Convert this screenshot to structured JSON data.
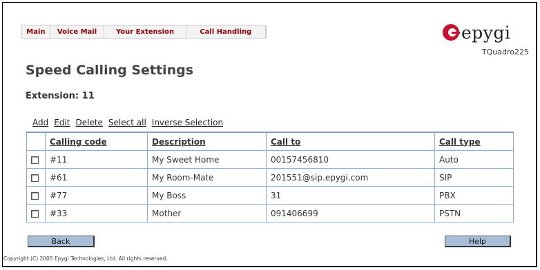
{
  "nav": {
    "tabs": [
      {
        "label": "Main"
      },
      {
        "label": "Voice Mail"
      },
      {
        "label": "Your Extension"
      },
      {
        "label": "Call Handling"
      }
    ]
  },
  "brand": {
    "logo_text": "epygi",
    "model": "TQuadro225",
    "accent": "#c8102e"
  },
  "page": {
    "title": "Speed Calling Settings",
    "extension_label": "Extension: 11"
  },
  "actions": {
    "add": "Add",
    "edit": "Edit",
    "delete": "Delete",
    "select_all": "Select all",
    "inverse": "Inverse Selection"
  },
  "table": {
    "headers": [
      "Calling code",
      "Description",
      "Call to",
      "Call type"
    ],
    "rows": [
      {
        "code": "#11",
        "description": "My Sweet Home",
        "call_to": "00157456810",
        "type": "Auto"
      },
      {
        "code": "#61",
        "description": "My Room-Mate",
        "call_to": "201551@sip.epygi.com",
        "type": "SIP"
      },
      {
        "code": "#77",
        "description": "My Boss",
        "call_to": "31",
        "type": "PBX"
      },
      {
        "code": "#33",
        "description": "Mother",
        "call_to": "091406699",
        "type": "PSTN"
      }
    ]
  },
  "buttons": {
    "back": "Back",
    "help": "Help"
  },
  "footer": {
    "copyright": "Copyright (C) 2005 Epygi Technologies, Ltd. All rights reserved."
  }
}
